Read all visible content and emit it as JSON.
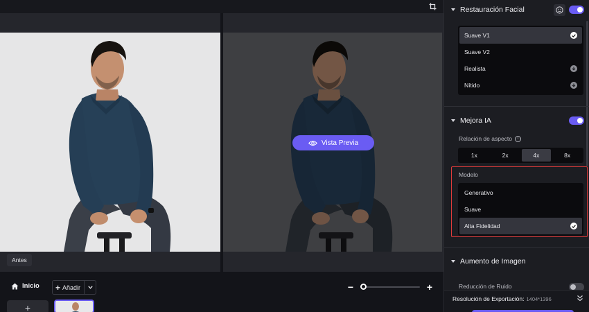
{
  "canvas": {
    "before_label": "Antes",
    "preview_button": "Vista Previa"
  },
  "bottom": {
    "home_label": "Inicio",
    "add_label": "Añadir",
    "zoom_level": 0.05
  },
  "panel": {
    "face_restoration": {
      "title": "Restauración Facial",
      "enabled": true,
      "options": [
        {
          "label": "Suave V1",
          "state": "selected"
        },
        {
          "label": "Suave V2",
          "state": "none"
        },
        {
          "label": "Realista",
          "state": "download"
        },
        {
          "label": "Nítido",
          "state": "download"
        }
      ]
    },
    "ai_enhance": {
      "title": "Mejora IA",
      "enabled": true,
      "aspect_label": "Relación de aspecto",
      "scales": [
        "1x",
        "2x",
        "4x",
        "8x"
      ],
      "selected_scale": "4x",
      "model_label": "Modelo",
      "models": [
        {
          "label": "Generativo",
          "state": "none"
        },
        {
          "label": "Suave",
          "state": "none"
        },
        {
          "label": "Alta Fidelidad",
          "state": "selected"
        }
      ]
    },
    "image_boost": {
      "title": "Aumento de Imagen",
      "noise_label": "Reducción de Ruido",
      "noise_enabled": false
    },
    "footer": {
      "export_label": "Resolución de Exportación:",
      "export_value": "1404*1396"
    }
  },
  "colors": {
    "accent": "#6a5cf3",
    "highlight_border": "#e23b3b"
  }
}
